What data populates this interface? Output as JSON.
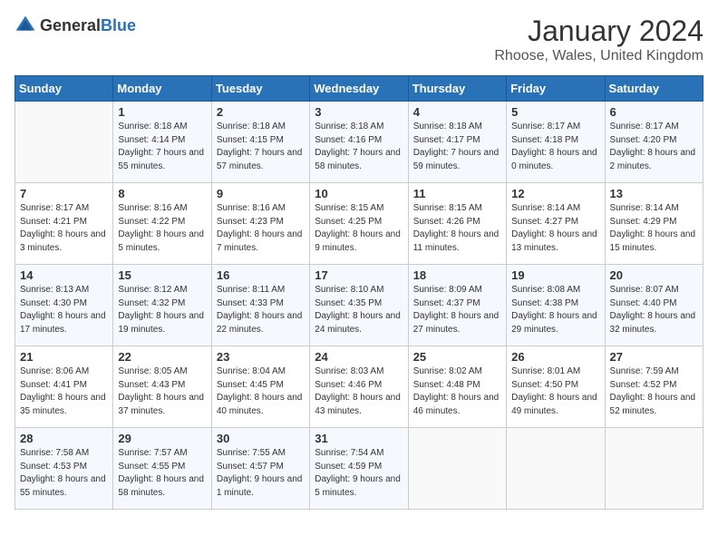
{
  "header": {
    "logo_general": "General",
    "logo_blue": "Blue",
    "month_year": "January 2024",
    "location": "Rhoose, Wales, United Kingdom"
  },
  "days_of_week": [
    "Sunday",
    "Monday",
    "Tuesday",
    "Wednesday",
    "Thursday",
    "Friday",
    "Saturday"
  ],
  "weeks": [
    [
      {
        "day": "",
        "sunrise": "",
        "sunset": "",
        "daylight": ""
      },
      {
        "day": "1",
        "sunrise": "Sunrise: 8:18 AM",
        "sunset": "Sunset: 4:14 PM",
        "daylight": "Daylight: 7 hours and 55 minutes."
      },
      {
        "day": "2",
        "sunrise": "Sunrise: 8:18 AM",
        "sunset": "Sunset: 4:15 PM",
        "daylight": "Daylight: 7 hours and 57 minutes."
      },
      {
        "day": "3",
        "sunrise": "Sunrise: 8:18 AM",
        "sunset": "Sunset: 4:16 PM",
        "daylight": "Daylight: 7 hours and 58 minutes."
      },
      {
        "day": "4",
        "sunrise": "Sunrise: 8:18 AM",
        "sunset": "Sunset: 4:17 PM",
        "daylight": "Daylight: 7 hours and 59 minutes."
      },
      {
        "day": "5",
        "sunrise": "Sunrise: 8:17 AM",
        "sunset": "Sunset: 4:18 PM",
        "daylight": "Daylight: 8 hours and 0 minutes."
      },
      {
        "day": "6",
        "sunrise": "Sunrise: 8:17 AM",
        "sunset": "Sunset: 4:20 PM",
        "daylight": "Daylight: 8 hours and 2 minutes."
      }
    ],
    [
      {
        "day": "7",
        "sunrise": "Sunrise: 8:17 AM",
        "sunset": "Sunset: 4:21 PM",
        "daylight": "Daylight: 8 hours and 3 minutes."
      },
      {
        "day": "8",
        "sunrise": "Sunrise: 8:16 AM",
        "sunset": "Sunset: 4:22 PM",
        "daylight": "Daylight: 8 hours and 5 minutes."
      },
      {
        "day": "9",
        "sunrise": "Sunrise: 8:16 AM",
        "sunset": "Sunset: 4:23 PM",
        "daylight": "Daylight: 8 hours and 7 minutes."
      },
      {
        "day": "10",
        "sunrise": "Sunrise: 8:15 AM",
        "sunset": "Sunset: 4:25 PM",
        "daylight": "Daylight: 8 hours and 9 minutes."
      },
      {
        "day": "11",
        "sunrise": "Sunrise: 8:15 AM",
        "sunset": "Sunset: 4:26 PM",
        "daylight": "Daylight: 8 hours and 11 minutes."
      },
      {
        "day": "12",
        "sunrise": "Sunrise: 8:14 AM",
        "sunset": "Sunset: 4:27 PM",
        "daylight": "Daylight: 8 hours and 13 minutes."
      },
      {
        "day": "13",
        "sunrise": "Sunrise: 8:14 AM",
        "sunset": "Sunset: 4:29 PM",
        "daylight": "Daylight: 8 hours and 15 minutes."
      }
    ],
    [
      {
        "day": "14",
        "sunrise": "Sunrise: 8:13 AM",
        "sunset": "Sunset: 4:30 PM",
        "daylight": "Daylight: 8 hours and 17 minutes."
      },
      {
        "day": "15",
        "sunrise": "Sunrise: 8:12 AM",
        "sunset": "Sunset: 4:32 PM",
        "daylight": "Daylight: 8 hours and 19 minutes."
      },
      {
        "day": "16",
        "sunrise": "Sunrise: 8:11 AM",
        "sunset": "Sunset: 4:33 PM",
        "daylight": "Daylight: 8 hours and 22 minutes."
      },
      {
        "day": "17",
        "sunrise": "Sunrise: 8:10 AM",
        "sunset": "Sunset: 4:35 PM",
        "daylight": "Daylight: 8 hours and 24 minutes."
      },
      {
        "day": "18",
        "sunrise": "Sunrise: 8:09 AM",
        "sunset": "Sunset: 4:37 PM",
        "daylight": "Daylight: 8 hours and 27 minutes."
      },
      {
        "day": "19",
        "sunrise": "Sunrise: 8:08 AM",
        "sunset": "Sunset: 4:38 PM",
        "daylight": "Daylight: 8 hours and 29 minutes."
      },
      {
        "day": "20",
        "sunrise": "Sunrise: 8:07 AM",
        "sunset": "Sunset: 4:40 PM",
        "daylight": "Daylight: 8 hours and 32 minutes."
      }
    ],
    [
      {
        "day": "21",
        "sunrise": "Sunrise: 8:06 AM",
        "sunset": "Sunset: 4:41 PM",
        "daylight": "Daylight: 8 hours and 35 minutes."
      },
      {
        "day": "22",
        "sunrise": "Sunrise: 8:05 AM",
        "sunset": "Sunset: 4:43 PM",
        "daylight": "Daylight: 8 hours and 37 minutes."
      },
      {
        "day": "23",
        "sunrise": "Sunrise: 8:04 AM",
        "sunset": "Sunset: 4:45 PM",
        "daylight": "Daylight: 8 hours and 40 minutes."
      },
      {
        "day": "24",
        "sunrise": "Sunrise: 8:03 AM",
        "sunset": "Sunset: 4:46 PM",
        "daylight": "Daylight: 8 hours and 43 minutes."
      },
      {
        "day": "25",
        "sunrise": "Sunrise: 8:02 AM",
        "sunset": "Sunset: 4:48 PM",
        "daylight": "Daylight: 8 hours and 46 minutes."
      },
      {
        "day": "26",
        "sunrise": "Sunrise: 8:01 AM",
        "sunset": "Sunset: 4:50 PM",
        "daylight": "Daylight: 8 hours and 49 minutes."
      },
      {
        "day": "27",
        "sunrise": "Sunrise: 7:59 AM",
        "sunset": "Sunset: 4:52 PM",
        "daylight": "Daylight: 8 hours and 52 minutes."
      }
    ],
    [
      {
        "day": "28",
        "sunrise": "Sunrise: 7:58 AM",
        "sunset": "Sunset: 4:53 PM",
        "daylight": "Daylight: 8 hours and 55 minutes."
      },
      {
        "day": "29",
        "sunrise": "Sunrise: 7:57 AM",
        "sunset": "Sunset: 4:55 PM",
        "daylight": "Daylight: 8 hours and 58 minutes."
      },
      {
        "day": "30",
        "sunrise": "Sunrise: 7:55 AM",
        "sunset": "Sunset: 4:57 PM",
        "daylight": "Daylight: 9 hours and 1 minute."
      },
      {
        "day": "31",
        "sunrise": "Sunrise: 7:54 AM",
        "sunset": "Sunset: 4:59 PM",
        "daylight": "Daylight: 9 hours and 5 minutes."
      },
      {
        "day": "",
        "sunrise": "",
        "sunset": "",
        "daylight": ""
      },
      {
        "day": "",
        "sunrise": "",
        "sunset": "",
        "daylight": ""
      },
      {
        "day": "",
        "sunrise": "",
        "sunset": "",
        "daylight": ""
      }
    ]
  ]
}
